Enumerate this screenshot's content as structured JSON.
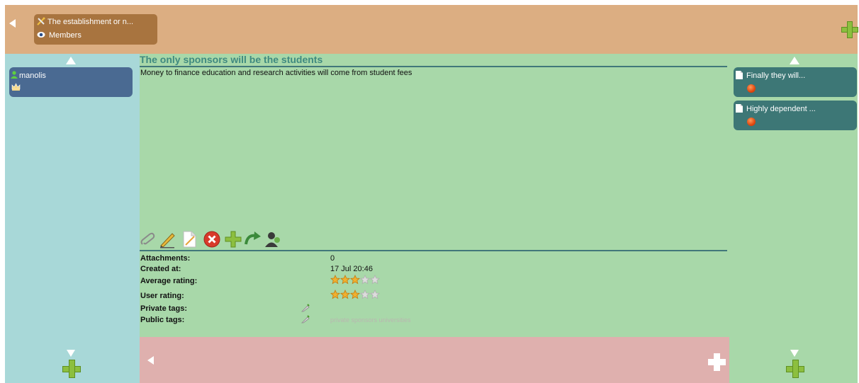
{
  "topbar": {
    "parent_title": "The establishment or n...",
    "parent_subtitle": "Members"
  },
  "left": {
    "members": [
      {
        "name": "manolis"
      }
    ]
  },
  "issue": {
    "title": "The only sponsors will be the students",
    "description": "Money to finance  education and research activities will come from student fees"
  },
  "toolbar": {
    "icons": [
      "attach-icon",
      "edit-icon",
      "document-icon",
      "delete-icon",
      "add-icon",
      "redo-icon",
      "user-admin-icon"
    ]
  },
  "details": {
    "attachments_label": "Attachments:",
    "attachments_value": "0",
    "created_label": "Created at:",
    "created_value": "17 Jul 20:46",
    "avg_rating_label": "Average rating:",
    "avg_rating_value": 3,
    "user_rating_label": "User rating:",
    "user_rating_value": 3,
    "rating_max": 5,
    "private_tags_label": "Private tags:",
    "public_tags_label": "Public tags:",
    "public_tags_value": "private sponsors universities"
  },
  "right": {
    "children": [
      {
        "label": "Finally they will..."
      },
      {
        "label": "Highly dependent ..."
      }
    ]
  },
  "colors": {
    "topbar": "#dcae82",
    "left": "#a8d8d8",
    "center": "#a8d8a9",
    "bottom": "#dfb0ae",
    "member_card": "#4a6a92",
    "child_card": "#3d7776",
    "title": "#3f8a80"
  }
}
